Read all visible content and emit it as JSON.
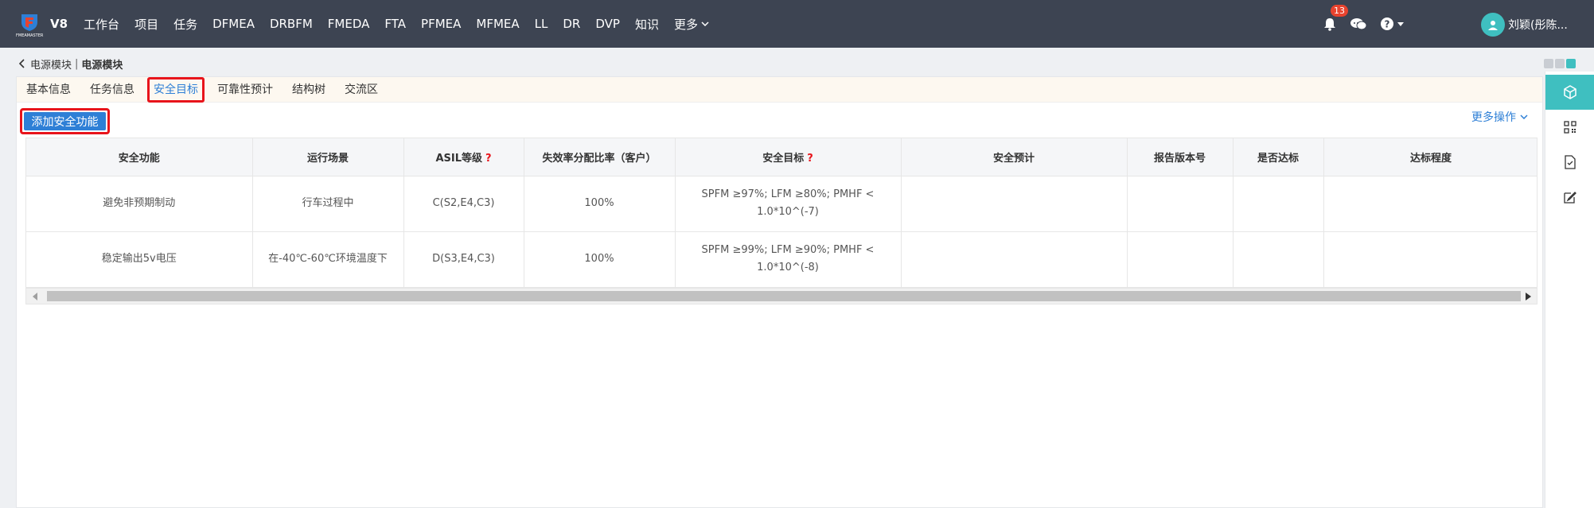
{
  "header": {
    "brand_text": "FMEAMASTER",
    "version": "V8",
    "nav": [
      "工作台",
      "项目",
      "任务",
      "DFMEA",
      "DRBFM",
      "FMEDA",
      "FTA",
      "PFMEA",
      "MFMEA",
      "LL",
      "DR",
      "DVP",
      "知识"
    ],
    "more_label": "更多",
    "notification_count": "13",
    "user_name": "刘颖(彤陈..."
  },
  "breadcrumb": {
    "parent": "电源模块",
    "separator": "|",
    "current": "电源模块"
  },
  "tabs": [
    {
      "label": "基本信息",
      "active": false
    },
    {
      "label": "任务信息",
      "active": false
    },
    {
      "label": "安全目标",
      "active": true
    },
    {
      "label": "可靠性预计",
      "active": false
    },
    {
      "label": "结构树",
      "active": false
    },
    {
      "label": "交流区",
      "active": false
    }
  ],
  "toolbar": {
    "add_label": "添加安全功能",
    "more_ops_label": "更多操作"
  },
  "table": {
    "columns": [
      "安全功能",
      "运行场景",
      "ASIL等级",
      "失效率分配比率（客户）",
      "安全目标",
      "安全预计",
      "报告版本号",
      "是否达标",
      "达标程度"
    ],
    "help_mark": "?",
    "rows": [
      [
        "避免非预期制动",
        "行车过程中",
        "C(S2,E4,C3)",
        "100%",
        "SPFM ≥97%; LFM ≥80%; PMHF < 1.0*10^(-7)",
        "",
        "",
        "",
        ""
      ],
      [
        "稳定输出5v电压",
        "在-40℃-60℃环境温度下",
        "D(S3,E4,C3)",
        "100%",
        "SPFM ≥99%; LFM ≥90%; PMHF < 1.0*10^(-8)",
        "",
        "",
        "",
        ""
      ]
    ]
  },
  "colors": {
    "topbar": "#3d4452",
    "accent": "#2e7fd6",
    "teal": "#3fbfc0",
    "highlight": "#e8141b"
  },
  "sidebar_icons": [
    "cube-icon",
    "qr-code-icon",
    "document-icon",
    "edit-icon"
  ]
}
